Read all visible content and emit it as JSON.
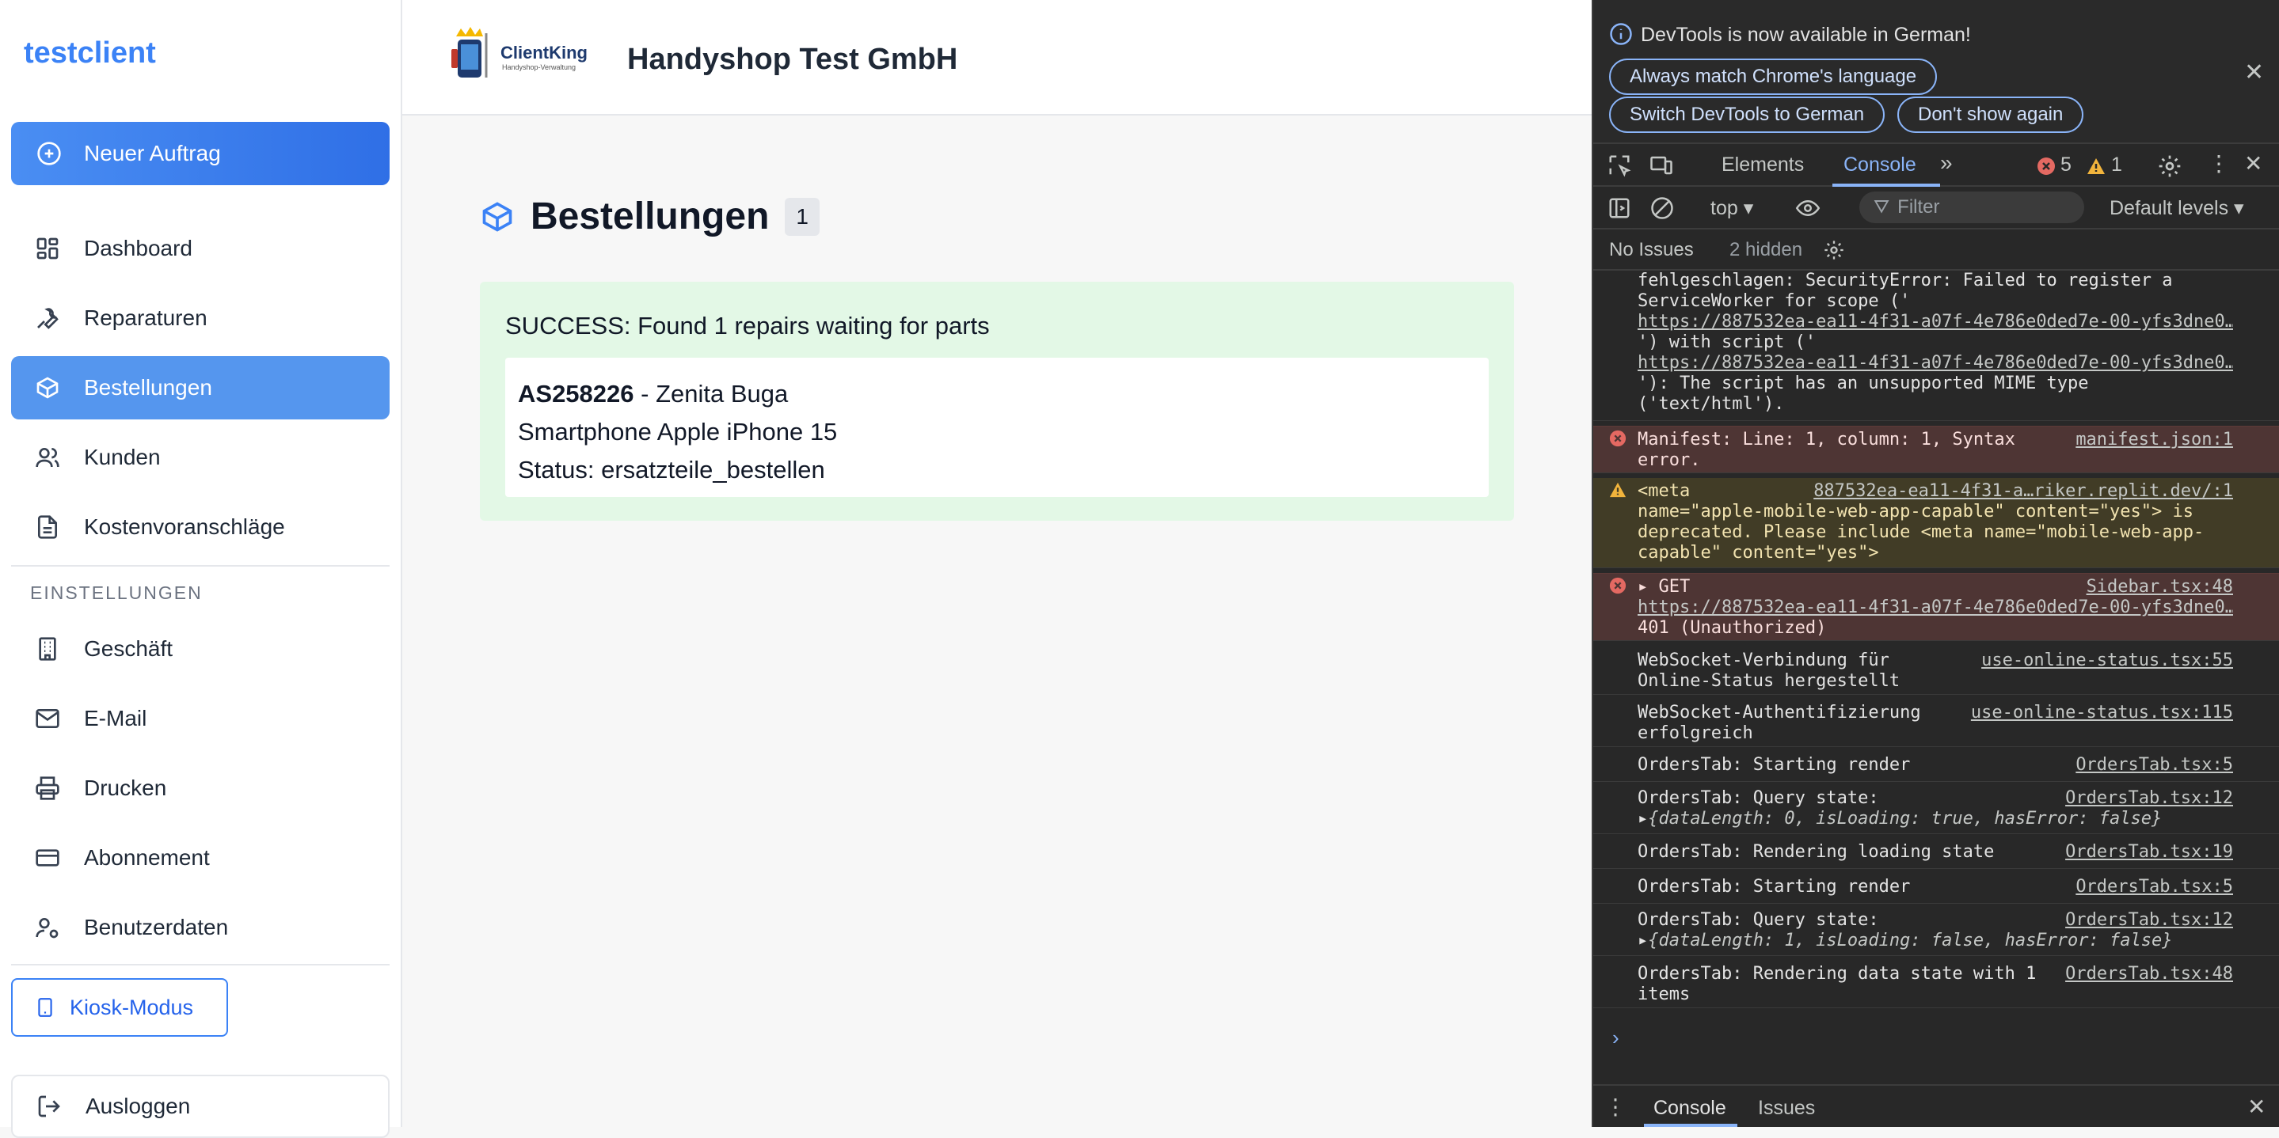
{
  "sidebar": {
    "brand": "testclient",
    "new_order": "Neuer Auftrag",
    "items": [
      {
        "label": "Dashboard"
      },
      {
        "label": "Reparaturen"
      },
      {
        "label": "Bestellungen"
      },
      {
        "label": "Kunden"
      },
      {
        "label": "Kostenvoranschläge"
      }
    ],
    "settings_label": "EINSTELLUNGEN",
    "settings_items": [
      {
        "label": "Geschäft"
      },
      {
        "label": "E-Mail"
      },
      {
        "label": "Drucken"
      },
      {
        "label": "Abonnement"
      },
      {
        "label": "Benutzerdaten"
      }
    ],
    "kiosk": "Kiosk-Modus",
    "logout": "Ausloggen"
  },
  "header": {
    "logo_text": "ClientKing",
    "logo_subtext": "Handyshop-Verwaltung",
    "company": "Handyshop Test GmbH"
  },
  "main": {
    "title": "Bestellungen",
    "count": "1",
    "success_message": "SUCCESS: Found 1 repairs waiting for parts",
    "repair": {
      "id": "AS258226",
      "customer": " - Zenita Buga",
      "device": "Smartphone Apple iPhone 15",
      "status": "Status: ersatzteile_bestellen"
    }
  },
  "devtools": {
    "info_text": "DevTools is now available in German!",
    "btn_match": "Always match Chrome's language",
    "btn_switch": "Switch DevTools to German",
    "btn_dont_show": "Don't show again",
    "tab_elements": "Elements",
    "tab_console": "Console",
    "error_count": "5",
    "warn_count": "1",
    "context": "top",
    "filter_placeholder": "Filter",
    "levels": "Default levels",
    "no_issues": "No Issues",
    "hidden": "2 hidden",
    "messages": {
      "m1_l1": "fehlgeschlagen: SecurityError: Failed to register a",
      "m1_l2": "ServiceWorker for scope ('",
      "m1_link1": "https://887532ea-ea11-4f31-a07f-4e786e0ded7e-00-yfs3dne0…",
      "m1_l3": "') with script ('",
      "m1_link2": "https://887532ea-ea11-4f31-a07f-4e786e0ded7e-00-yfs3dne0…",
      "m1_l4": "'): The script has an unsupported MIME type",
      "m1_l5": "('text/html').",
      "m2_text": "Manifest: Line: 1, column: 1, Syntax",
      "m2_text2": "error.",
      "m2_src": "manifest.json:1",
      "m3_l1": "<meta",
      "m3_src": "887532ea-ea11-4f31-a…riker.replit.dev/:1",
      "m3_l2": "name=\"apple-mobile-web-app-capable\" content=\"yes\"> is",
      "m3_l3": "deprecated. Please include <meta name=\"mobile-web-app-",
      "m3_l4": "capable\" content=\"yes\">",
      "m4_l1": "GET",
      "m4_src": "Sidebar.tsx:48",
      "m4_link": "https://887532ea-ea11-4f31-a07f-4e786e0ded7e-00-yfs3dne0…",
      "m4_l3": "401 (Unauthorized)",
      "m5_l1": "WebSocket-Verbindung für",
      "m5_l2": "Online-Status hergestellt",
      "m5_src": "use-online-status.tsx:55",
      "m6_l1": "WebSocket-Authentifizierung",
      "m6_l2": "erfolgreich",
      "m6_src": "use-online-status.tsx:115",
      "m7": "OrdersTab: Starting render",
      "m7_src": "OrdersTab.tsx:5",
      "m8": "OrdersTab: Query state:",
      "m8_src": "OrdersTab.tsx:12",
      "m8_obj": "{dataLength: 0, isLoading: true, hasError: false}",
      "m9": "OrdersTab: Rendering loading state",
      "m9_src": "OrdersTab.tsx:19",
      "m10": "OrdersTab: Starting render",
      "m10_src": "OrdersTab.tsx:5",
      "m11": "OrdersTab: Query state:",
      "m11_src": "OrdersTab.tsx:12",
      "m11_obj": "{dataLength: 1, isLoading: false, hasError: false}",
      "m12_l1": "OrdersTab: Rendering data state with 1",
      "m12_l2": "items",
      "m12_src": "OrdersTab.tsx:48"
    },
    "bottom_console": "Console",
    "bottom_issues": "Issues"
  },
  "colors": {
    "accent": "#3b82f6",
    "success_bg": "#e3f8e6",
    "devtools_bg": "#282828"
  }
}
